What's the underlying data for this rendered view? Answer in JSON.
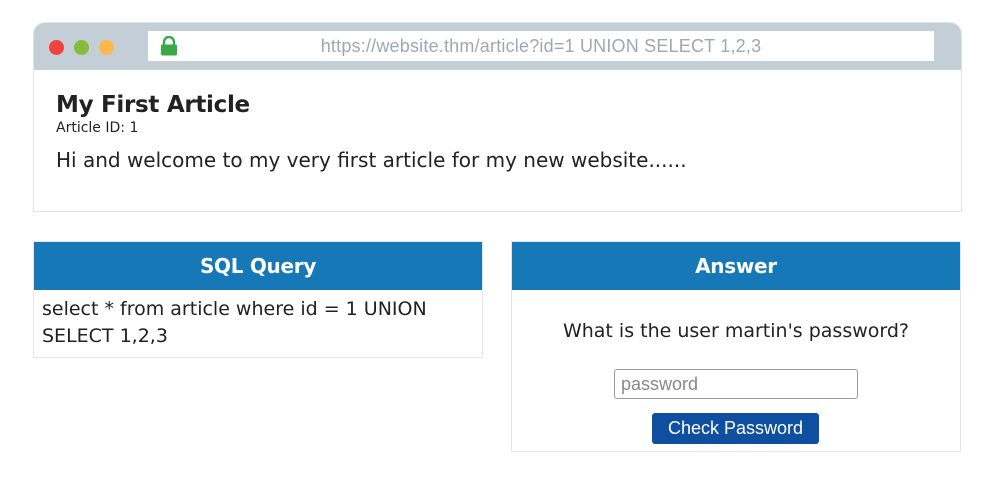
{
  "browser": {
    "url": "https://website.thm/article?id=1 UNION SELECT 1,2,3",
    "traffic_lights": [
      "close",
      "minimize",
      "maximize"
    ]
  },
  "article": {
    "title": "My First Article",
    "meta": "Article ID: 1",
    "body": "Hi and welcome to my very first article for my new website......"
  },
  "sql_panel": {
    "header": "SQL Query",
    "query": "select * from article where id = 1 UNION SELECT 1,2,3"
  },
  "answer_panel": {
    "header": "Answer",
    "question": "What is the user martin's password?",
    "password_placeholder": "password",
    "button_label": "Check Password"
  },
  "colors": {
    "chrome_bar": "#c4ced7",
    "panel_header": "#1778b8",
    "button": "#0f4fa0",
    "lock_icon": "#39a94a"
  },
  "icons": {
    "lock": "lock-icon"
  }
}
